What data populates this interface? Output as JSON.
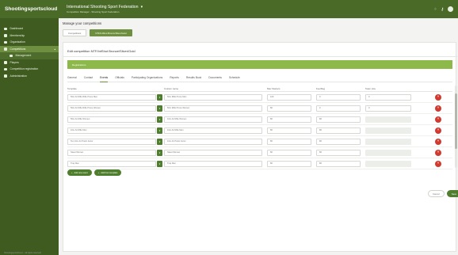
{
  "header": {
    "logo": "Shootingsportscloud",
    "federation": "International Shooting Sport Federation",
    "federation_sub": "Competition Manager - Shooting Sport Federation"
  },
  "sidebar": {
    "items": [
      {
        "label": "Dashboard",
        "icon": "home-icon",
        "active": false,
        "sub": false
      },
      {
        "label": "Membership",
        "icon": "card-icon",
        "active": false,
        "sub": false
      },
      {
        "label": "Organisation",
        "icon": "users-icon",
        "active": false,
        "sub": false
      },
      {
        "label": "Competitions",
        "icon": "trophy-icon",
        "active": true,
        "sub": false
      },
      {
        "label": "Management",
        "icon": "list-icon",
        "active": false,
        "sub": true
      },
      {
        "label": "Players",
        "icon": "user-icon",
        "active": false,
        "sub": false
      },
      {
        "label": "Competition registration",
        "icon": "flag-icon",
        "active": false,
        "sub": false
      },
      {
        "label": "Administration",
        "icon": "gear-icon",
        "active": false,
        "sub": false
      }
    ]
  },
  "page": {
    "title": "Manage your competitions",
    "buttons": [
      "Competitions",
      "NTF/IntShot Bronze/Silver/Gold"
    ],
    "card_title": "Edit competition NTF/IntShot Bronze/Silver/Gold",
    "banner": "Registrations",
    "tabs": [
      "General",
      "Contact",
      "Events",
      "Officials",
      "Participating Organizations",
      "Reports",
      "Results Book",
      "Documents",
      "Schedule"
    ],
    "active_tab": "Events"
  },
  "table": {
    "headers": [
      "Template",
      "Custom name",
      "Max Starters",
      "Fee/Reg",
      "Team size"
    ],
    "rows": [
      {
        "template": "50m Air Rifle Rifle Prone Men",
        "custom": "50m Rifle Prone Men",
        "max": "100",
        "fee": "0",
        "team": "0"
      },
      {
        "template": "50m Air Rifle Rifle Prone Women",
        "custom": "50m Rifle Prone Women",
        "max": "80",
        "fee": "0",
        "team": "0"
      },
      {
        "template": "50m Air Rifle Women",
        "custom": "10m Air Rifle Women",
        "max": "80",
        "fee": "80",
        "team": ""
      },
      {
        "template": "10m Air Rifle Men",
        "custom": "10m Air Rifle Men",
        "max": "80",
        "fee": "80",
        "team": ""
      },
      {
        "template": "Ten 10m Air Pistol Junior",
        "custom": "10m Air Pistol Junior",
        "max": "80",
        "fee": "80",
        "team": ""
      },
      {
        "template": "Skeet Women",
        "custom": "Skeet Women",
        "max": "80",
        "fee": "80",
        "team": ""
      },
      {
        "template": "Trap Men",
        "custom": "Trap Men",
        "max": "80",
        "fee": "80",
        "team": ""
      }
    ]
  },
  "actions": {
    "add_event": "Add new event",
    "add_template": "Add from template",
    "cancel": "Cancel",
    "save": "Save"
  },
  "footer": {
    "copyright": "Shootingsportscloud – all rights reserved"
  },
  "colors": {
    "topbar": "#4a6a28",
    "sidebar": "#3f5b20",
    "accent": "#6d8f3f",
    "banner": "#8db84a",
    "delete": "#d2392f"
  }
}
